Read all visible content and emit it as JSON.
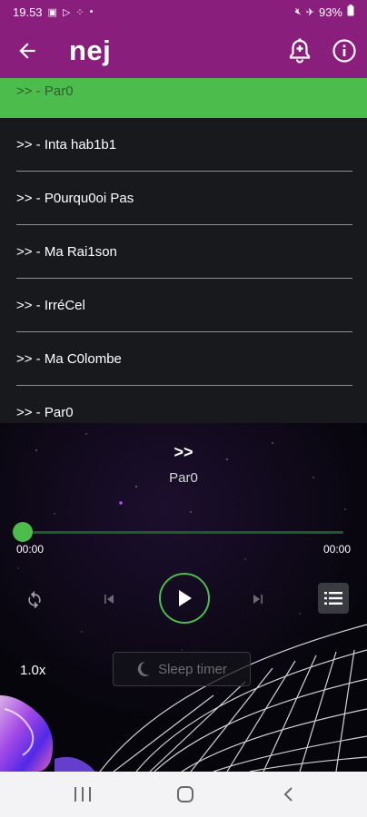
{
  "status_bar": {
    "time": "19.53",
    "battery": "93%"
  },
  "app_bar": {
    "title": "nej",
    "icons": [
      "arrow-back-icon",
      "bell-alarm-icon",
      "info-icon"
    ]
  },
  "tracks": [
    {
      "label": ">> - Par0",
      "active": true
    },
    {
      "label": ">> - Inta hab1b1",
      "active": false
    },
    {
      "label": ">> - P0urqu0oi Pas",
      "active": false
    },
    {
      "label": ">> - Ma Rai1son",
      "active": false
    },
    {
      "label": ">> - IrréCel",
      "active": false
    },
    {
      "label": ">> - Ma C0lombe",
      "active": false
    },
    {
      "label": ">> - Par0",
      "active": false
    }
  ],
  "player": {
    "artist": ">>",
    "title": "Par0",
    "time_elapsed": "00:00",
    "time_total": "00:00",
    "progress": 0,
    "speed": "1.0x",
    "sleep_timer_label": "Sleep timer"
  },
  "colors": {
    "primary": "#8a1e7c",
    "accent": "#4cbc4c",
    "list_bg": "#17191d",
    "player_bg": "#0b0712"
  }
}
